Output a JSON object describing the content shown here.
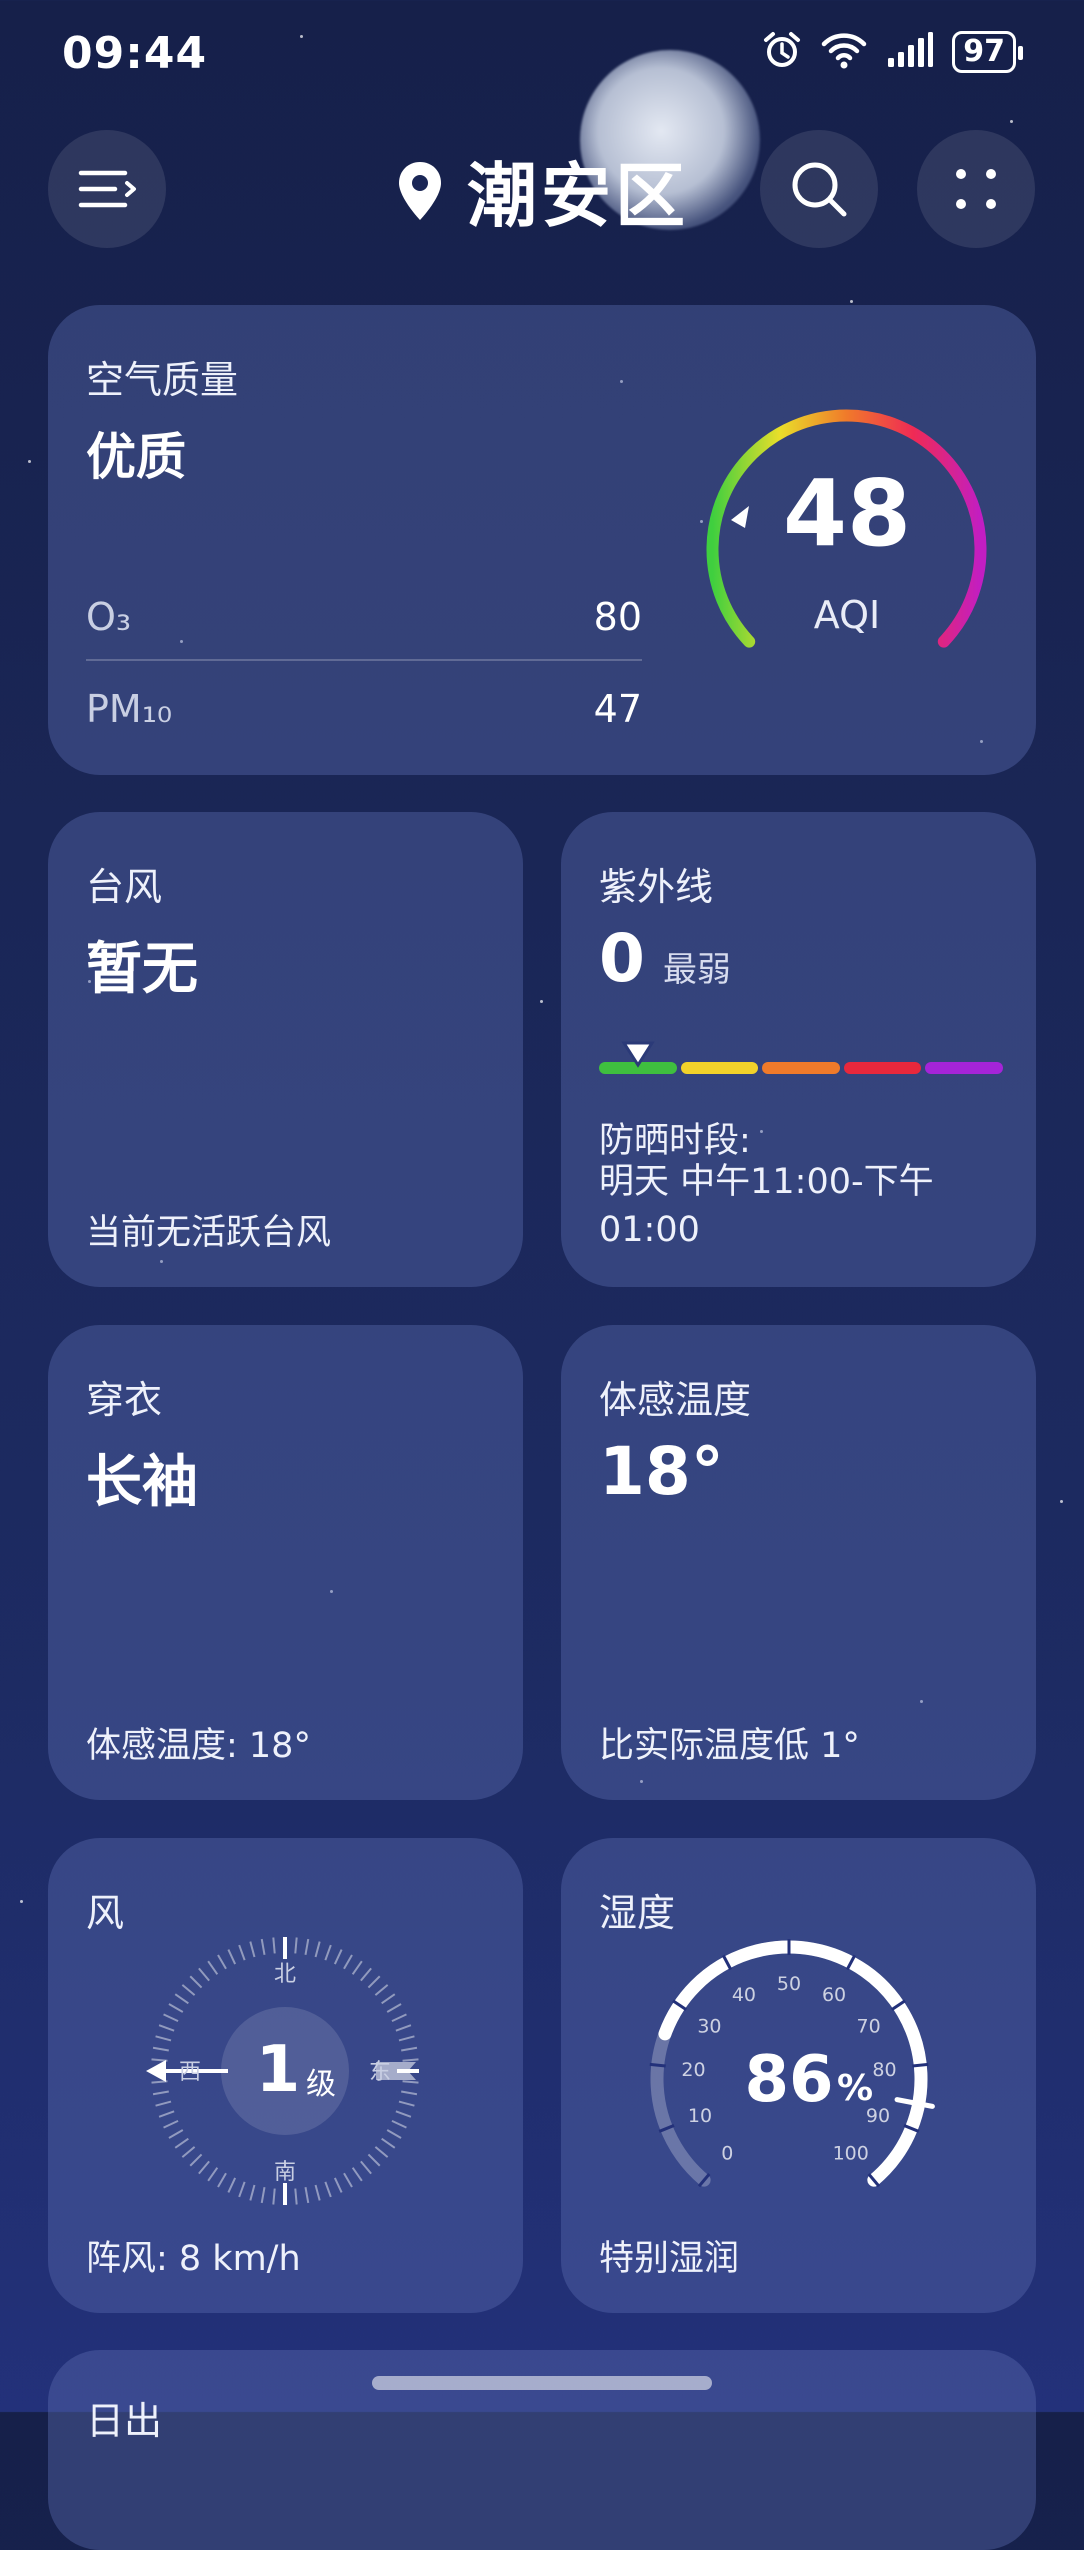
{
  "status_bar": {
    "time": "09:44",
    "battery": "97"
  },
  "header": {
    "location": "潮安区"
  },
  "air_quality": {
    "title": "空气质量",
    "level": "优质",
    "aqi_value": "48",
    "aqi_label": "AQI",
    "pollutants": [
      {
        "name": "O₃",
        "value": "80"
      },
      {
        "name": "PM₁₀",
        "value": "47"
      }
    ]
  },
  "typhoon": {
    "title": "台风",
    "status": "暂无",
    "note": "当前无活跃台风"
  },
  "uv": {
    "title": "紫外线",
    "value": "0",
    "level": "最弱",
    "protect_label": "防晒时段:",
    "protect_time": "明天 中午11:00-下午01:00",
    "scale_colors": [
      "#3fbf3f",
      "#f2d22a",
      "#f07a2a",
      "#e8283c",
      "#a524d8"
    ]
  },
  "clothing": {
    "title": "穿衣",
    "value": "长袖",
    "note": "体感温度: 18°"
  },
  "feels_like": {
    "title": "体感温度",
    "value": "18°",
    "note": "比实际温度低 1°"
  },
  "wind": {
    "title": "风",
    "level": "1",
    "level_unit": "级",
    "gust": "阵风: 8 km/h",
    "dirs": {
      "n": "北",
      "s": "南",
      "w": "西",
      "e": "东"
    }
  },
  "humidity": {
    "title": "湿度",
    "value": "86",
    "unit": "%",
    "note": "特别湿润",
    "ticks": [
      "0",
      "10",
      "20",
      "30",
      "40",
      "50",
      "60",
      "70",
      "80",
      "90",
      "100"
    ]
  },
  "sunrise": {
    "title": "日出"
  }
}
